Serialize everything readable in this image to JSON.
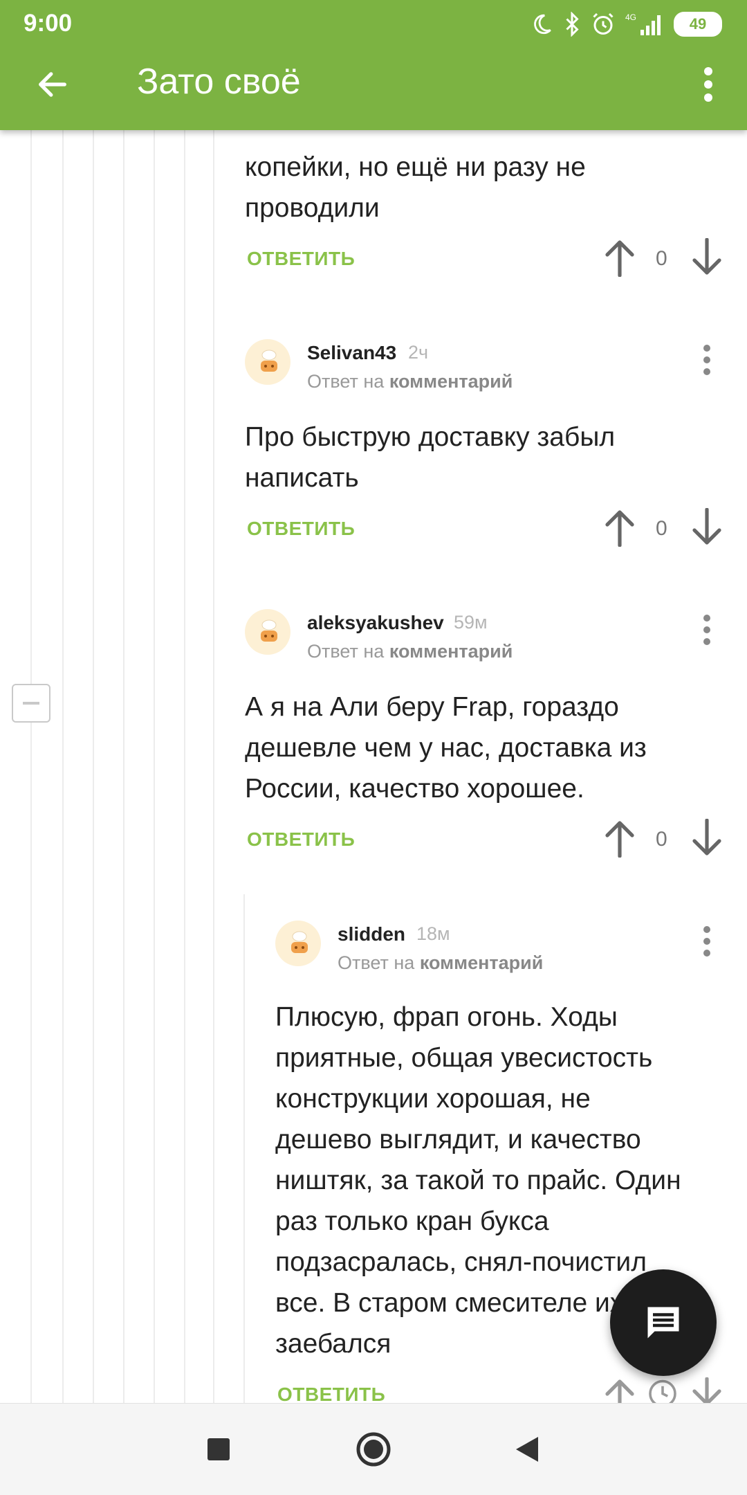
{
  "status_bar": {
    "time": "9:00",
    "network": "4G",
    "battery": "49"
  },
  "app_bar": {
    "title": "Зато своё"
  },
  "comments": [
    {
      "partial_text": "копейки, но ещё ни разу не проводили",
      "reply_label": "ОТВЕТИТЬ",
      "score": "0"
    },
    {
      "author": "Selivan43",
      "time": "2ч",
      "reply_to_prefix": "Ответ на",
      "reply_to_link": "комментарий",
      "text": "Про быструю доставку забыл написать",
      "reply_label": "ОТВЕТИТЬ",
      "score": "0"
    },
    {
      "author": "aleksyakushev",
      "time": "59м",
      "reply_to_prefix": "Ответ на",
      "reply_to_link": "комментарий",
      "text": "А я на Али беру Frap, гораздо дешевле чем у нас, доставка из России, качество хорошее.",
      "reply_label": "ОТВЕТИТЬ",
      "score": "0"
    },
    {
      "author": "slidden",
      "time": "18м",
      "reply_to_prefix": "Ответ на",
      "reply_to_link": "комментарий",
      "text": "Плюсую, фрап огонь. Ходы приятные, общая увесистость конструкции хорошая, не дешево выглядит, и качество ништяк, за такой то прайс. Один раз только кран букса подзасралась, снял-почистил все. В старом смесителе их заебался",
      "reply_label": "ОТВЕТИТЬ"
    }
  ],
  "icons": {
    "back": "arrow-left-icon",
    "menu": "more-vert-icon",
    "fab": "comment-icon",
    "upvote": "arrow-up-icon",
    "downvote": "arrow-down-icon"
  },
  "colors": {
    "brand_green": "#7cb342",
    "reply_green": "#8ac249",
    "fab_dark": "#1d1d1d"
  }
}
